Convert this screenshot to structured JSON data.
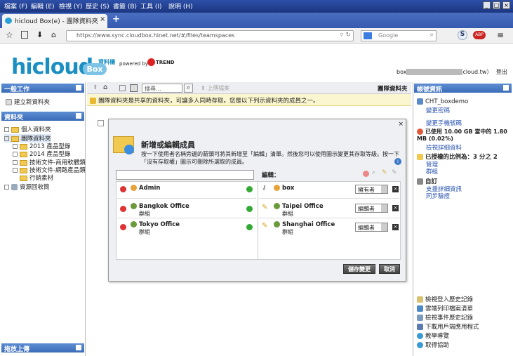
{
  "browser": {
    "menus": [
      "檔案 (F)",
      "編輯 (E)",
      "檢視 (Y)",
      "歷史 (S)",
      "書籤 (B)",
      "工具 (I)",
      "說明 (H)"
    ],
    "tab_title": "hicloud Box(e) - 團隊資料夾",
    "url": "https://www.sync.cloudbox.hinet.net/#/files/teamspaces",
    "search_placeholder": "Google"
  },
  "header": {
    "logo": "hicloud",
    "logo_badge": "資料櫃",
    "logo_box": "Box",
    "powered": "powered by",
    "trend": "TREND",
    "user_prefix": "box",
    "user_suffix": "cloud.tw）",
    "logout": "登出"
  },
  "left": {
    "work_header": "一般工作",
    "new_folder": "建立新資料夾",
    "folders_header": "資料夾",
    "tree": [
      "個人資料夾",
      "團隊資料夾",
      "2013 產品型錄",
      "2014 產品型錄",
      "技術文件-商用軟體類",
      "技術文件-網路產品類",
      "行銷素材",
      "資源回收筒"
    ],
    "upload_header": "拖放上傳"
  },
  "toolbar": {
    "search_placeholder": "搜尋...",
    "upload": "上傳檔案",
    "location": "團隊資料夾"
  },
  "notice": "團隊資料夾是共享的資料夾，可讓多人同時存取。您是以下列示資料夾的成員之一。",
  "dialog": {
    "title": "新增或編輯成員",
    "desc": "按一下使用者名稱旁邊的箭頭可將其新增至「編輯」清單。然後您可以使用圖示變更其存取等級。按一下「沒有存取權」圖示可刪除所選取的成員。",
    "edit_label": "編輯：",
    "left_members": [
      {
        "name": "Admin",
        "sub": ""
      },
      {
        "name": "Bangkok Office",
        "sub": "群組"
      },
      {
        "name": "Tokyo Office",
        "sub": "群組"
      }
    ],
    "right_members": [
      {
        "name": "box",
        "sub": "",
        "role": "擁有者"
      },
      {
        "name": "Taipei Office",
        "sub": "群組",
        "role": "編輯者"
      },
      {
        "name": "Shanghai Office",
        "sub": "群組",
        "role": "編輯者"
      }
    ],
    "save": "儲存變更",
    "cancel": "取消"
  },
  "right": {
    "header": "帳號資訊",
    "username": "CHT_boxdemo",
    "change_password": "變更密碼",
    "change_phone": "變更手機號碼",
    "usage": "已使用 10.00 GB 當中的 1.80 MB (0.02%)",
    "usage_detail": "檢視詳細資料",
    "share_ratio": "已授權的比例為：3 分之 2",
    "manage": "管理",
    "group": "群組",
    "custom": "自訂",
    "support": "支援詳細資訊",
    "sync": "同步驗證",
    "links": [
      "檢視登入歷史記錄",
      "雲端列印檔案清單",
      "檢視事件歷史記錄",
      "下載用戶端應用程式",
      "教學導覽",
      "取得協助"
    ]
  },
  "colors": {
    "accent": "#3b6cb8",
    "logo": "#1b8fc2",
    "notice_bg": "#fbf6cf"
  }
}
